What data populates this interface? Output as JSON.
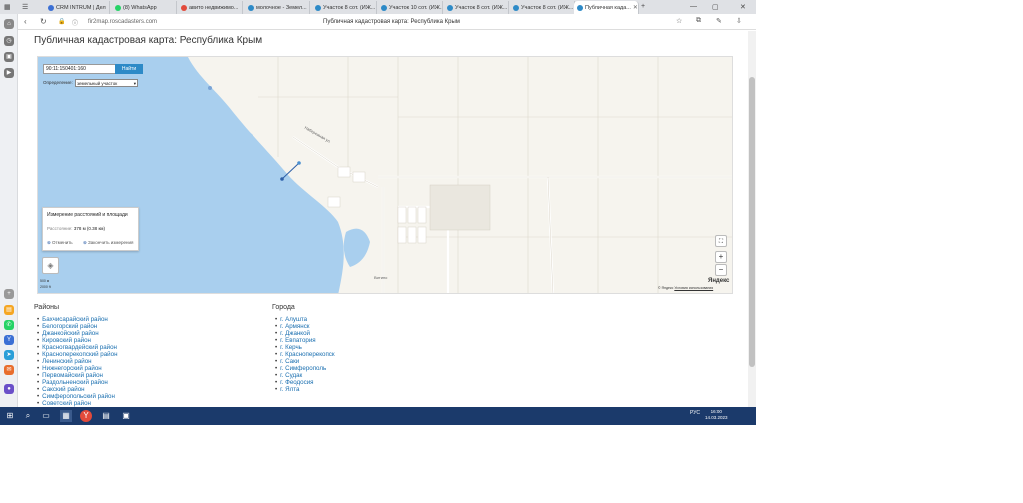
{
  "browser": {
    "tabs": [
      {
        "label": "CRM INTRUM | Дел",
        "color": "#3b6fd4"
      },
      {
        "label": "(8) WhatsApp",
        "color": "#25d366"
      },
      {
        "label": "авито недвижимо...",
        "color": "#e24a3b"
      },
      {
        "label": "молочное - Земел...",
        "color": "#2d8ac7"
      },
      {
        "label": "Участок 8 сот. (ИЖ...",
        "color": "#2d8ac7"
      },
      {
        "label": "Участок 10 сот. (ИЖ...",
        "color": "#2d8ac7"
      },
      {
        "label": "Участок 8 сот. (ИЖ...",
        "color": "#2d8ac7"
      },
      {
        "label": "Участок 8 сот. (ИЖ...",
        "color": "#2d8ac7"
      },
      {
        "label": "Публичная када...",
        "color": "#2d8ac7",
        "active": true
      }
    ],
    "url": "fir2map.roscadasters.com",
    "page_tab_title": "Публичная кадастровая карта: Республика Крым"
  },
  "page": {
    "title": "Публичная кадастровая карта: Республика Крым"
  },
  "map": {
    "search_value": "90:11:150401:160",
    "find_button": "Найти",
    "definition_label": "Определение:",
    "definition_value": "земельный участок",
    "measure_title": "Измерение расстояний и площади",
    "measure_distance_label": "Расстояние:",
    "measure_distance_value": "378 м (0.38 км)",
    "measure_action_reset": "Отменить",
    "measure_action_finish": "Закончить измерения",
    "scale_1": "500 м",
    "scale_2": "2000 ft",
    "logo": "Яндекс",
    "attribution_prefix": "© Яндекс",
    "attribution_link": "Условия использования",
    "place_label": "Витино",
    "zoom_in": "+",
    "zoom_out": "−"
  },
  "districts": {
    "heading": "Районы",
    "items": [
      "Бахчисарайский район",
      "Белогорский район",
      "Джанкойский район",
      "Кировский район",
      "Красногвардейский район",
      "Красноперекопский район",
      "Ленинский район",
      "Нижнегорский район",
      "Первомайский район",
      "Раздольненский район",
      "Сакский район",
      "Симферопольский район",
      "Советский район"
    ]
  },
  "cities": {
    "heading": "Города",
    "items": [
      "г. Алушта",
      "г. Армянск",
      "г. Джанкой",
      "г. Евпатория",
      "г. Керчь",
      "г. Красноперекопск",
      "г. Саки",
      "г. Симферополь",
      "г. Судак",
      "г. Феодосия",
      "г. Ялта"
    ]
  },
  "taskbar": {
    "lang": "РУС",
    "time": "16:00",
    "date": "14.03.2023"
  },
  "colors": {
    "sea": "#a9cfee",
    "land": "#f6f4ee",
    "link": "#1a6fb0",
    "button": "#2d8ac7",
    "taskbar": "#1b3a6b"
  }
}
